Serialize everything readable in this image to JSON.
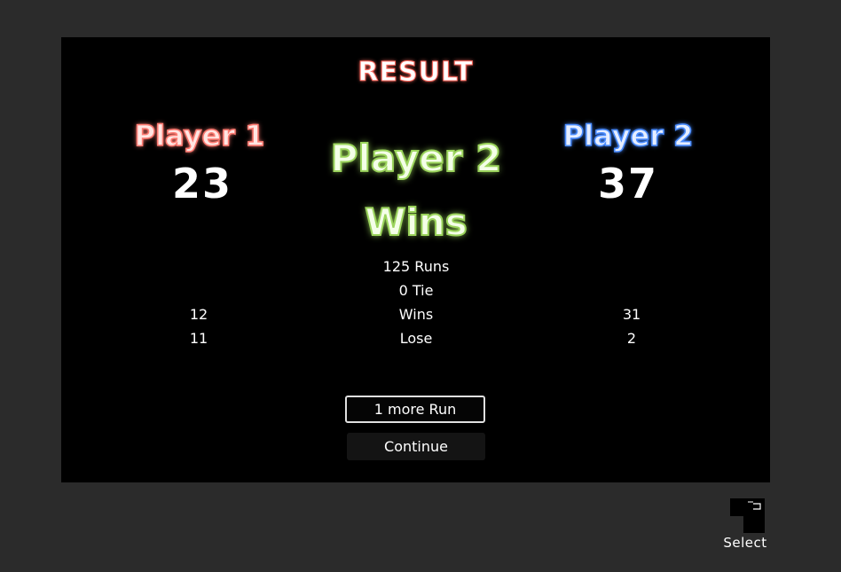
{
  "title": "RESULT",
  "player1": {
    "name": "Player 1",
    "score": "23",
    "wins": "12",
    "lose": "11"
  },
  "player2": {
    "name": "Player 2",
    "score": "37",
    "wins": "31",
    "lose": "2"
  },
  "winner": {
    "line1": "Player 2",
    "line2": "Wins"
  },
  "stats": {
    "runs": "125 Runs",
    "tie": "0 Tie",
    "wins_label": "Wins",
    "lose_label": "Lose"
  },
  "buttons": {
    "more_run": "1 more Run",
    "continue": "Continue"
  },
  "select": {
    "label": "Select",
    "icon": "select-key-icon"
  }
}
